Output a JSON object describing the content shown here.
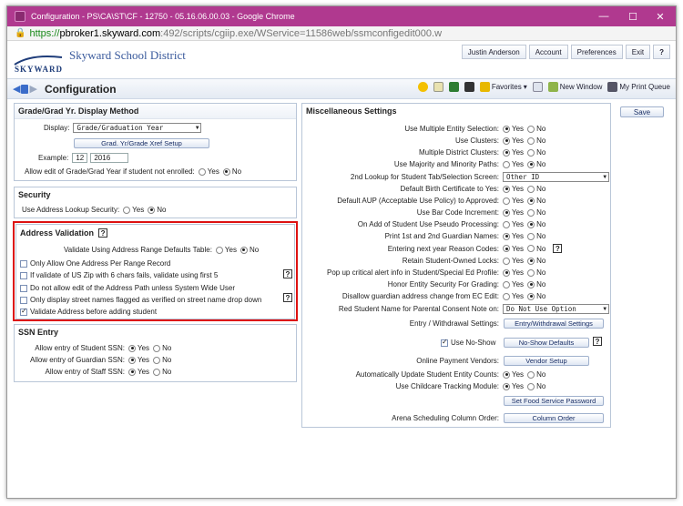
{
  "window": {
    "title": "Configuration - PS\\CA\\ST\\CF - 12750 - 05.16.06.00.03 - Google Chrome",
    "min": "—",
    "max": "☐",
    "close": "✕"
  },
  "url": {
    "scheme": "https://",
    "host": "pbroker1.skyward.com",
    "path": ":492/scripts/cgiip.exe/WService=11586web/ssmconfigedit000.w"
  },
  "header": {
    "logo": "SKYWARD",
    "district": "Skyward School District",
    "nav": [
      "Justin Anderson",
      "Account",
      "Preferences",
      "Exit",
      "?"
    ]
  },
  "toolbar": {
    "title": "Configuration",
    "favorites": "Favorites",
    "new_window": "New Window",
    "print_queue": "My Print Queue"
  },
  "grade": {
    "title": "Grade/Grad Yr. Display Method",
    "display_label": "Display:",
    "display_value": "Grade/Graduation Year",
    "xref_button": "Grad. Yr/Grade Xref Setup",
    "example_label": "Example:",
    "example_grade": "12",
    "example_year": "2016",
    "allow_edit_label": "Allow edit of Grade/Grad Year if student not enrolled:",
    "yes": "Yes",
    "no": "No",
    "allow_edit_value": "No"
  },
  "security": {
    "title": "Security",
    "lookup_label": "Use Address Lookup Security:",
    "yes": "Yes",
    "no": "No",
    "value": "No"
  },
  "address": {
    "title": "Address Validation",
    "help": "?",
    "range_label": "Validate Using Address Range Defaults Table:",
    "yes": "Yes",
    "no": "No",
    "range_value": "No",
    "options": [
      {
        "label": "Only Allow One Address Per Range Record",
        "checked": false,
        "help": ""
      },
      {
        "label": "If validate of US Zip with 6 chars fails, validate using first 5",
        "checked": false,
        "help": "?"
      },
      {
        "label": "Do not allow edit of the Address Path unless System Wide User",
        "checked": false,
        "help": ""
      },
      {
        "label": "Only display street names flagged as verified on street name drop down",
        "checked": false,
        "help": "?"
      },
      {
        "label": "Validate Address before adding student",
        "checked": true,
        "help": ""
      }
    ]
  },
  "ssn": {
    "title": "SSN Entry",
    "yes": "Yes",
    "no": "No",
    "rows": [
      {
        "label": "Allow entry of Student SSN:",
        "value": "Yes"
      },
      {
        "label": "Allow entry of Guardian SSN:",
        "value": "Yes"
      },
      {
        "label": "Allow entry of Staff SSN:",
        "value": "Yes"
      }
    ]
  },
  "misc": {
    "title": "Miscellaneous Settings",
    "yes": "Yes",
    "no": "No",
    "radio_rows_a": [
      {
        "label": "Use Multiple Entity Selection:",
        "value": "Yes"
      },
      {
        "label": "Use Clusters:",
        "value": "Yes"
      },
      {
        "label": "Multiple District Clusters:",
        "value": "Yes"
      },
      {
        "label": "Use Majority and Minority Paths:",
        "value": "No"
      }
    ],
    "lookup_label": "2nd Lookup for Student Tab/Selection Screen:",
    "lookup_value": "Other ID",
    "radio_rows_b": [
      {
        "label": "Default Birth Certificate to Yes:",
        "value": "Yes"
      },
      {
        "label": "Default AUP (Acceptable Use Policy) to Approved:",
        "value": "No"
      },
      {
        "label": "Use Bar Code Increment:",
        "value": "Yes"
      },
      {
        "label": "On Add of Student Use Pseudo Processing:",
        "value": "No"
      },
      {
        "label": "Print 1st and 2nd Guardian Names:",
        "value": "Yes"
      },
      {
        "label": "Entering next year Reason Codes:",
        "value": "Yes",
        "help": "?"
      },
      {
        "label": "Retain Student-Owned Locks:",
        "value": "No"
      },
      {
        "label": "Pop up critical alert info in Student/Special Ed Profile:",
        "value": "Yes"
      },
      {
        "label": "Honor Entity Security For Grading:",
        "value": "No"
      },
      {
        "label": "Disallow guardian address change from EC Edit:",
        "value": "No"
      }
    ],
    "red_label": "Red Student Name for Parental Consent Note on:",
    "red_value": "Do Not Use Option",
    "entry_label": "Entry / Withdrawal Settings:",
    "entry_button": "Entry/Withdrawal Settings",
    "noshow_label": "Use No-Show",
    "noshow_checked": true,
    "noshow_button": "No-Show Defaults",
    "noshow_help": "?",
    "payment_label": "Online Payment Vendors:",
    "payment_button": "Vendor Setup",
    "auto_label": "Automatically Update Student Entity Counts:",
    "auto_value": "Yes",
    "childcare_label": "Use Childcare Tracking Module:",
    "childcare_value": "Yes",
    "food_button": "Set Food Service Password",
    "arena_label": "Arena Scheduling Column Order:",
    "arena_button": "Column Order"
  },
  "save_button": "Save"
}
